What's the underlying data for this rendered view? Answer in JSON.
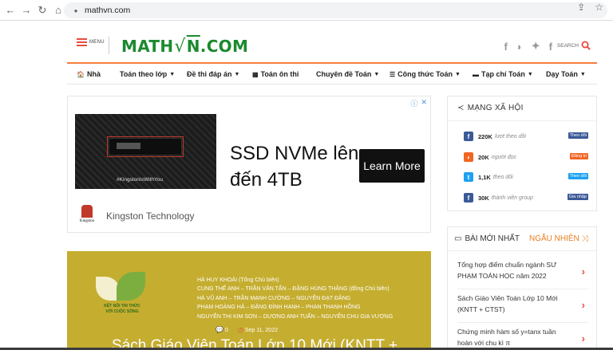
{
  "browser": {
    "url": "mathvn.com"
  },
  "header": {
    "menu_label": "MENU",
    "logo_prefix": "MATH",
    "logo_root": "√",
    "logo_nn": "N",
    "logo_suffix": ".COM",
    "search_label": "SEARCH"
  },
  "nav": {
    "items": [
      {
        "label": "Nhà",
        "icon": "home-icon",
        "dropdown": false
      },
      {
        "label": "Toán theo lớp",
        "dropdown": true
      },
      {
        "label": "Đề thi đáp án",
        "dropdown": true
      },
      {
        "label": "Toán ôn thi",
        "icon": "calculator-icon",
        "dropdown": false
      },
      {
        "label": "Chuyên đề Toán",
        "dropdown": true
      },
      {
        "label": "Công thức Toán",
        "icon": "list-icon",
        "dropdown": true
      },
      {
        "label": "Tạp chí Toán",
        "icon": "book-icon",
        "dropdown": true
      },
      {
        "label": "Dạy Toán",
        "dropdown": true
      }
    ]
  },
  "ad": {
    "image_tag": "#KingstonIsWithYou",
    "headline_1": "SSD NVMe lên",
    "headline_2": "đến 4TB",
    "cta": "Learn More",
    "brand": "Kingston Technology",
    "brand_logo_text": "Kingston"
  },
  "article": {
    "book_caption_1": "KẾT NỐI TRI THỨC",
    "book_caption_2": "VỚI CUỘC SỐNG",
    "authors": [
      "HÀ HUY KHOÁI (Tổng Chủ biên)",
      "CUNG THẾ ANH – TRẦN VĂN TẤN – ĐẶNG HÙNG THẮNG (đồng Chủ biên)",
      "HÀ VŨ ANH – TRẦN MẠNH CƯỜNG – NGUYỄN ĐẠT ĐĂNG",
      "PHẠM HOÀNG HÀ – ĐẶNG ĐÌNH HANH – PHAN THANH HỒNG",
      "NGUYỄN THỊ KIM SƠN – DƯƠNG ANH TUẤN – NGUYỄN CHU GIA VƯỢNG"
    ],
    "comments": "0",
    "date": "Sep 11, 2022",
    "title": "Sách Giáo Viên Toán Lớp 10 Mới (KNTT +"
  },
  "sidebar": {
    "social_title": "MẠNG XÃ HỘI",
    "social": [
      {
        "icon": "facebook-icon",
        "glyph": "f",
        "color": "#3b5998",
        "count": "220K",
        "desc": "lượt theo dõi",
        "action": "Theo dõi",
        "action_color": "#3b5998"
      },
      {
        "icon": "rss-icon",
        "glyph": "◗",
        "color": "#f26522",
        "count": "20K",
        "desc": "người đọc",
        "action": "Đăng kí",
        "action_color": "#f26522"
      },
      {
        "icon": "twitter-icon",
        "glyph": "t",
        "color": "#1da1f2",
        "count": "1,1K",
        "desc": "theo dõi",
        "action": "Theo dõi",
        "action_color": "#1da1f2"
      },
      {
        "icon": "facebook-group-icon",
        "glyph": "f",
        "color": "#3b5998",
        "count": "30K",
        "desc": "thành viên group",
        "action": "Gia nhập",
        "action_color": "#3b5998"
      }
    ],
    "tab_new": "BÀI MỚI NHẤT",
    "tab_random": "NGẪU NHIÊN",
    "posts": [
      {
        "title": "Tổng hợp điểm chuẩn ngành SƯ PHẠM TOÁN HỌC năm 2022"
      },
      {
        "title": "Sách Giáo Viên Toán Lớp 10 Mới (KNTT + CTST)"
      },
      {
        "title": "Chứng minh hàm số y=tanx tuần hoàn với chu kì π"
      }
    ]
  }
}
